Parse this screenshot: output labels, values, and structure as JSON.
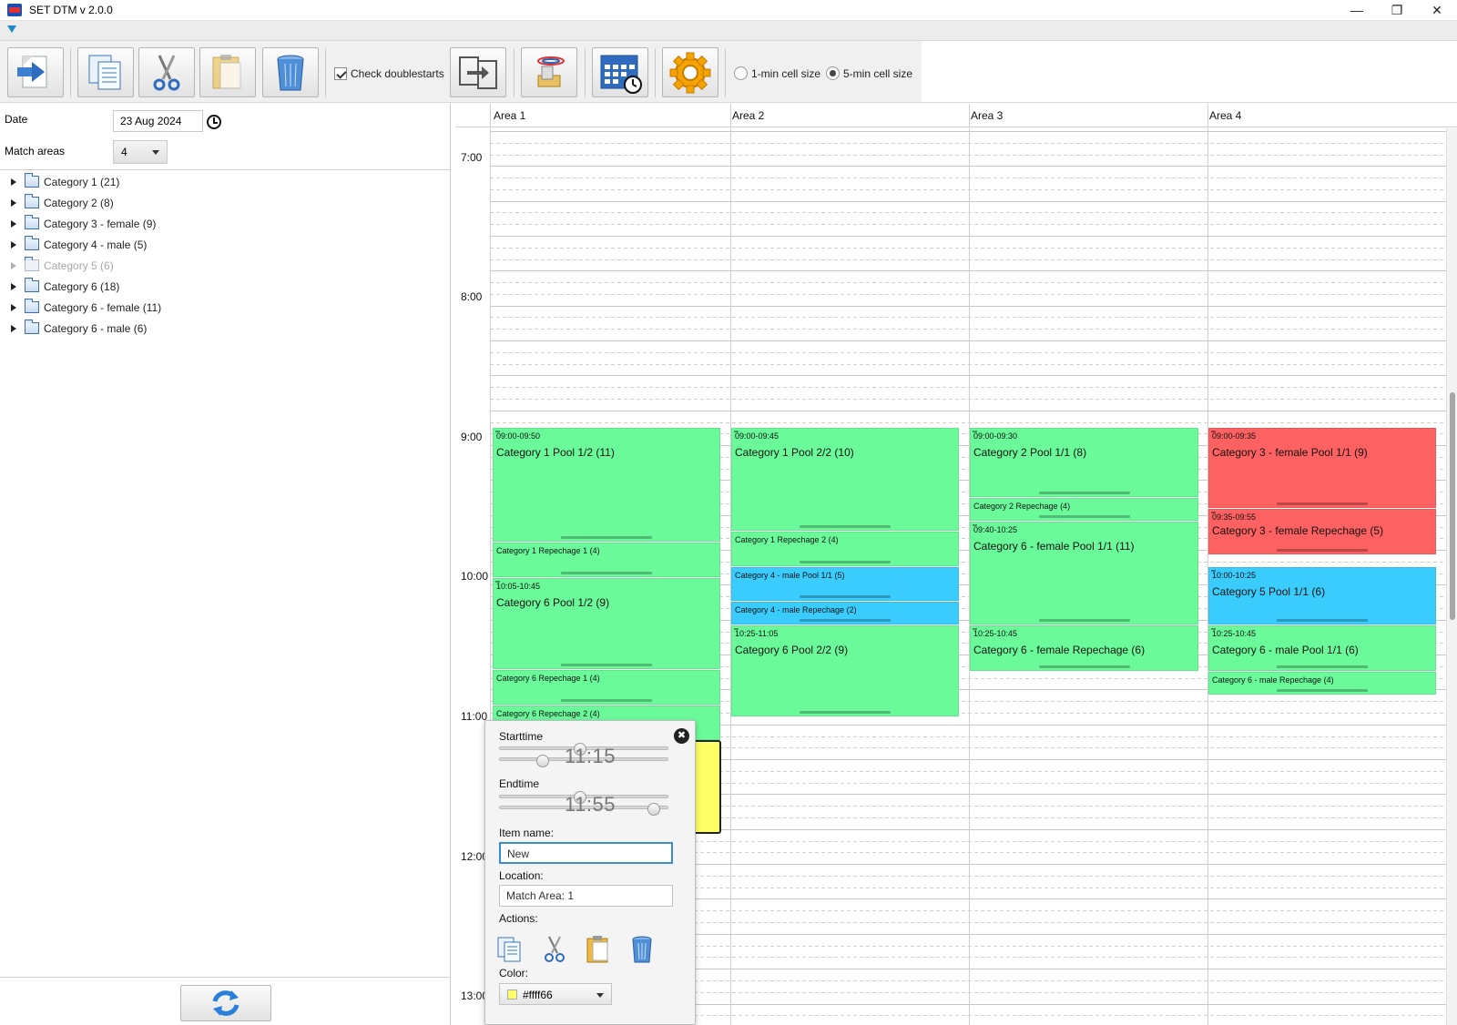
{
  "window": {
    "title": "SET DTM v 2.0.0",
    "minimize_glyph": "—",
    "maximize_glyph": "❐",
    "close_glyph": "✕"
  },
  "toolbar": {
    "check_doublestarts_label": "Check doublestarts",
    "check_doublestarts_checked": true,
    "cell_size_1_label": "1-min cell size",
    "cell_size_5_label": "5-min cell size",
    "cell_size_selected": "5-min cell size",
    "icons": [
      "export-icon",
      "copy-icon",
      "cut-icon",
      "paste-icon",
      "delete-icon",
      "import-icon",
      "logo-import-icon",
      "calendar-clock-icon",
      "settings-gear-icon"
    ]
  },
  "left": {
    "date_label": "Date",
    "date_value": "23 Aug 2024",
    "areas_label": "Match areas",
    "areas_value": "4",
    "tree": [
      {
        "label": "Category 1 (21)",
        "disabled": false
      },
      {
        "label": "Category 2 (8)",
        "disabled": false
      },
      {
        "label": "Category 3 - female (9)",
        "disabled": false
      },
      {
        "label": "Category 4 - male (5)",
        "disabled": false
      },
      {
        "label": "Category 5 (6)",
        "disabled": true
      },
      {
        "label": "Category 6 (18)",
        "disabled": false
      },
      {
        "label": "Category 6 - female (11)",
        "disabled": false
      },
      {
        "label": "Category 6 - male (6)",
        "disabled": false
      }
    ]
  },
  "calendar": {
    "areas": [
      "Area 1",
      "Area 2",
      "Area 3",
      "Area 4"
    ],
    "times": [
      "7:00",
      "8:00",
      "9:00",
      "10:00",
      "11:00",
      "12:00",
      "13:00"
    ],
    "events": {
      "a1_pool12": {
        "time": "09:00-09:50",
        "name": "Category 1 Pool 1/2 (11)"
      },
      "a1_rep1": {
        "name": "Category 1 Repechage 1 (4)"
      },
      "a1_c6pool12": {
        "time": "10:05-10:45",
        "name": "Category 6 Pool 1/2 (9)"
      },
      "a1_c6rep1": {
        "name": "Category 6 Repechage 1 (4)"
      },
      "a1_c6rep2": {
        "name": "Category 6 Repechage 2 (4)"
      },
      "a2_pool22": {
        "time": "09:00-09:45",
        "name": "Category 1 Pool 2/2 (10)"
      },
      "a2_rep2": {
        "name": "Category 1 Repechage 2 (4)"
      },
      "a2_c4pool": {
        "name": "Category 4 - male Pool 1/1 (5)"
      },
      "a2_c4rep": {
        "name": "Category 4 - male Repechage (2)"
      },
      "a2_c6pool22": {
        "time": "10:25-11:05",
        "name": "Category 6 Pool 2/2 (9)"
      },
      "a3_c2pool": {
        "time": "09:00-09:30",
        "name": "Category 2 Pool 1/1 (8)"
      },
      "a3_c2rep": {
        "name": "Category 2 Repechage (4)"
      },
      "a3_c6fpool": {
        "time": "09:40-10:25",
        "name": "Category 6 - female Pool 1/1 (11)"
      },
      "a3_c6frep": {
        "time": "10:25-10:45",
        "name": "Category 6 - female Repechage (6)"
      },
      "a4_c3fpool": {
        "time": "09:00-09:35",
        "name": "Category 3 - female Pool 1/1 (9)"
      },
      "a4_c3frep": {
        "time": "09:35-09:55",
        "name": "Category 3 - female Repechage (5)"
      },
      "a4_c5pool": {
        "time": "10:00-10:25",
        "name": "Category 5 Pool 1/1 (6)"
      },
      "a4_c6mpool": {
        "time": "10:25-10:45",
        "name": "Category 6 - male Pool 1/1 (6)"
      },
      "a4_c6mrep": {
        "name": "Category 6 - male Repechage (4)"
      }
    },
    "colors": {
      "green": "#6bfa9a",
      "red": "#fd6161",
      "blue": "#3accfd",
      "new_item": "#ffff66"
    }
  },
  "editor": {
    "starttime_label": "Starttime",
    "starttime_value": "11:15",
    "endtime_label": "Endtime",
    "endtime_value": "11:55",
    "item_name_label": "Item name:",
    "item_name_value": "New",
    "location_label": "Location:",
    "location_value": "Match Area: 1",
    "actions_label": "Actions:",
    "color_label": "Color:",
    "color_value": "#ffff66",
    "close_glyph": "✖"
  }
}
